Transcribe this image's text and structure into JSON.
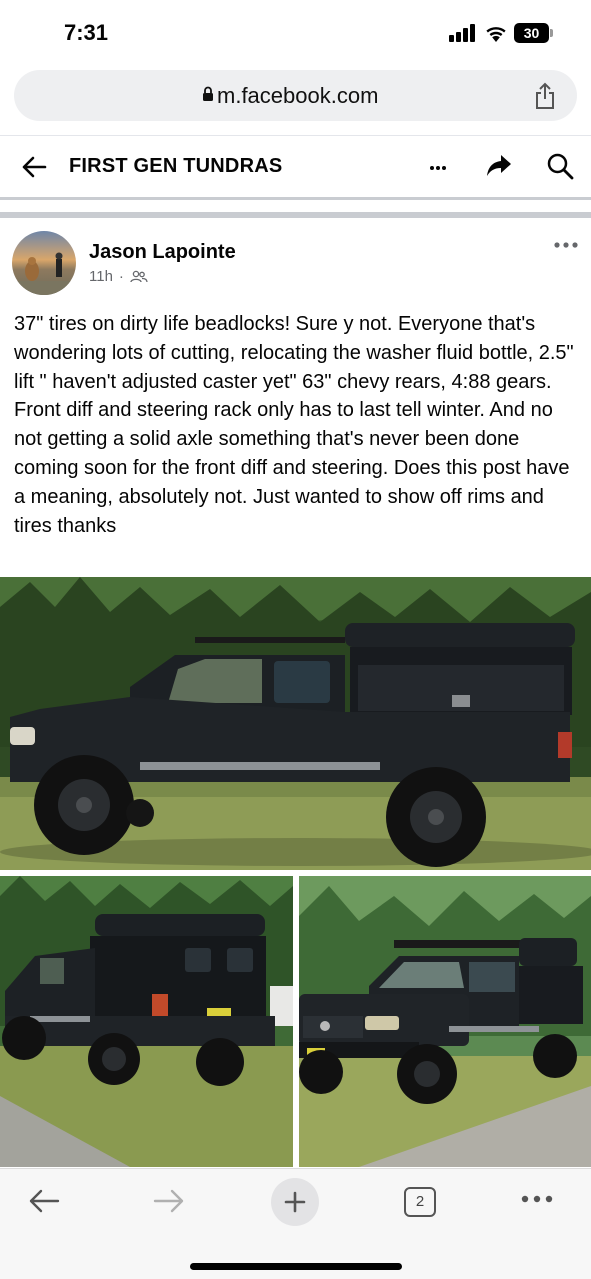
{
  "status_bar": {
    "time": "7:31",
    "battery": "30"
  },
  "browser": {
    "url": "m.facebook.com",
    "open_tabs": "2"
  },
  "group": {
    "title": "FIRST GEN TUNDRAS"
  },
  "post": {
    "author": "Jason Lapointe",
    "time": "11h",
    "separator": "·",
    "privacy_icon": "members-icon",
    "text": "37\" tires on dirty life beadlocks! Sure y not. Everyone that's wondering lots of cutting,  relocating the washer fluid bottle, 2.5\" lift \" haven't adjusted caster yet\" 63\" chevy rears, 4:88 gears.  Front diff and steering rack only has to last tell winter. And no not getting a solid axle something that's never been done coming soon for the front diff and steering. Does this post have a meaning, absolutely not. Just wanted to show off rims and tires thanks",
    "photos": [
      {
        "name": "truck-side-view"
      },
      {
        "name": "truck-rear-view"
      },
      {
        "name": "truck-front-view"
      }
    ]
  },
  "colors": {
    "secondary_text": "#65676b",
    "divider": "#c9ccd1",
    "url_bar_bg": "#eeeff1"
  }
}
